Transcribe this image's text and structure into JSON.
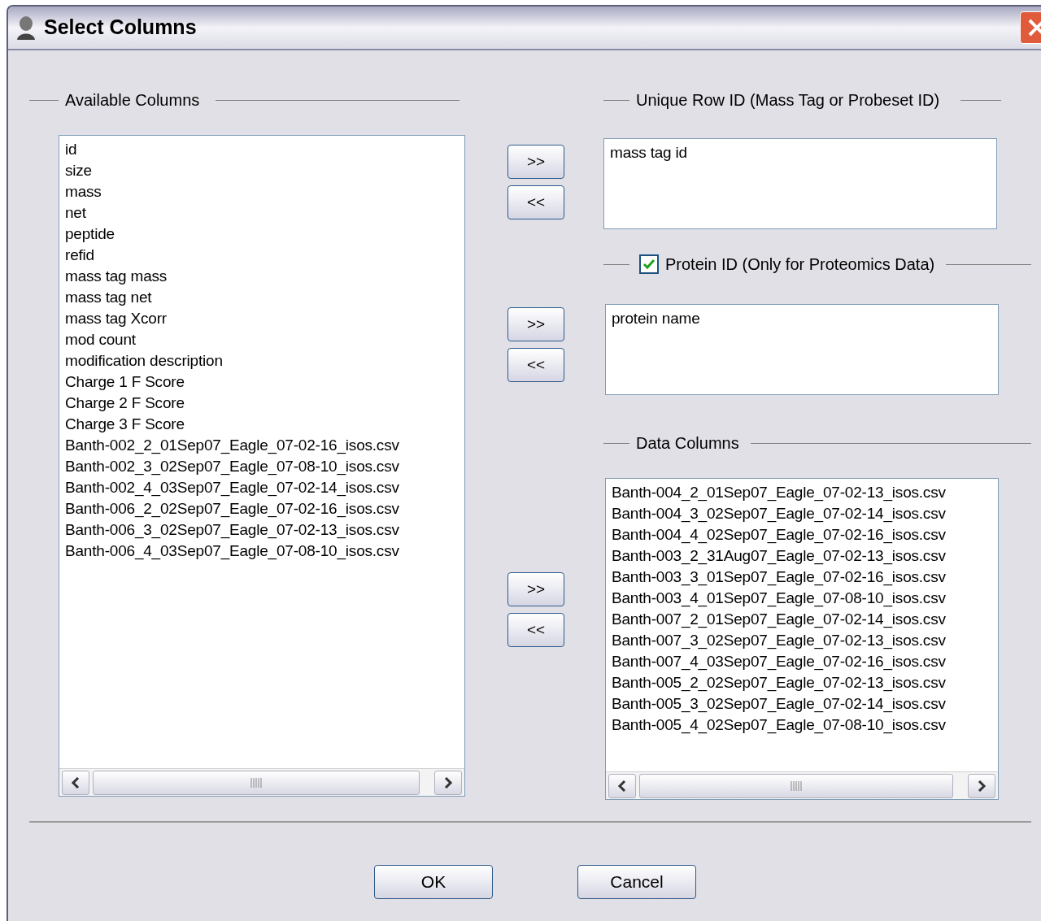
{
  "window": {
    "title": "Select Columns"
  },
  "available": {
    "label": "Available Columns",
    "items": [
      "id",
      "size",
      "mass",
      "net",
      "peptide",
      "refid",
      "mass tag mass",
      "mass tag net",
      "mass tag Xcorr",
      "mod count",
      "modification description",
      "Charge 1 F Score",
      "Charge 2 F Score",
      "Charge 3 F Score",
      "Banth-002_2_01Sep07_Eagle_07-02-16_isos.csv",
      "Banth-002_3_02Sep07_Eagle_07-08-10_isos.csv",
      "Banth-002_4_03Sep07_Eagle_07-02-14_isos.csv",
      "Banth-006_2_02Sep07_Eagle_07-02-16_isos.csv",
      "Banth-006_3_02Sep07_Eagle_07-02-13_isos.csv",
      "Banth-006_4_03Sep07_Eagle_07-08-10_isos.csv"
    ]
  },
  "move_buttons": [
    {
      "add": ">>",
      "remove": "<<"
    },
    {
      "add": ">>",
      "remove": "<<"
    },
    {
      "add": ">>",
      "remove": "<<"
    }
  ],
  "unique_row_id": {
    "label": "Unique Row ID (Mass Tag or Probeset ID)",
    "items": [
      "mass tag id"
    ]
  },
  "protein_id": {
    "label": "Protein ID (Only for Proteomics Data)",
    "checked": true,
    "items": [
      "protein name"
    ]
  },
  "data_columns": {
    "label": "Data Columns",
    "items": [
      "Banth-004_2_01Sep07_Eagle_07-02-13_isos.csv",
      "Banth-004_3_02Sep07_Eagle_07-02-14_isos.csv",
      "Banth-004_4_02Sep07_Eagle_07-02-16_isos.csv",
      "Banth-003_2_31Aug07_Eagle_07-02-13_isos.csv",
      "Banth-003_3_01Sep07_Eagle_07-02-16_isos.csv",
      "Banth-003_4_01Sep07_Eagle_07-08-10_isos.csv",
      "Banth-007_2_01Sep07_Eagle_07-02-14_isos.csv",
      "Banth-007_3_02Sep07_Eagle_07-02-13_isos.csv",
      "Banth-007_4_03Sep07_Eagle_07-02-16_isos.csv",
      "Banth-005_2_02Sep07_Eagle_07-02-13_isos.csv",
      "Banth-005_3_02Sep07_Eagle_07-02-14_isos.csv",
      "Banth-005_4_02Sep07_Eagle_07-08-10_isos.csv"
    ]
  },
  "buttons": [
    "OK",
    "Cancel"
  ]
}
